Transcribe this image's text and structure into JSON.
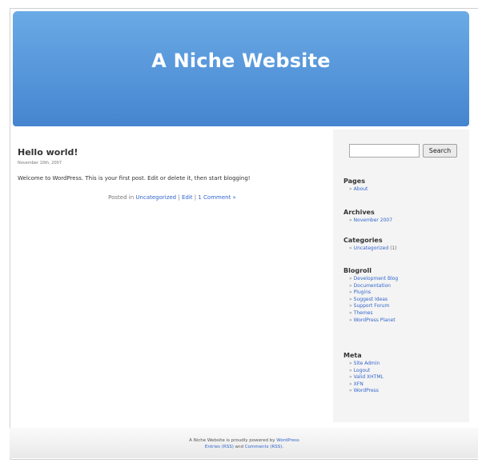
{
  "site": {
    "title": "A Niche Website"
  },
  "post": {
    "title": "Hello world!",
    "date": "November 10th, 2007",
    "body": "Welcome to WordPress. This is your first post. Edit or delete it, then start blogging!",
    "posted_in_label": "Posted in",
    "category": "Uncategorized",
    "sep1": "|",
    "edit": "Edit",
    "sep2": "|",
    "comments": "1 Comment »"
  },
  "sidebar": {
    "search": {
      "value": "",
      "button": "Search"
    },
    "pages": {
      "heading": "Pages",
      "items": [
        "About"
      ]
    },
    "archives": {
      "heading": "Archives",
      "items": [
        "November 2007"
      ]
    },
    "categories": {
      "heading": "Categories",
      "items": [
        {
          "label": "Uncategorized",
          "count": "(1)"
        }
      ]
    },
    "blogroll": {
      "heading": "Blogroll",
      "items": [
        "Development Blog",
        "Documentation",
        "Plugins",
        "Suggest Ideas",
        "Support Forum",
        "Themes",
        "WordPress Planet"
      ]
    },
    "meta": {
      "heading": "Meta",
      "items": [
        "Site Admin",
        "Logout",
        "Valid XHTML",
        "XFN",
        "WordPress"
      ]
    },
    "bullet": "»"
  },
  "footer": {
    "line1_prefix": "A Niche Website is proudly powered by",
    "line1_link": "WordPress",
    "entries_link": "Entries (RSS)",
    "and": "and",
    "comments_link": "Comments (RSS)",
    "end": "."
  },
  "colors": {
    "header_top": "#6aaae6",
    "header_bottom": "#4585cf",
    "link": "#3366cc"
  }
}
